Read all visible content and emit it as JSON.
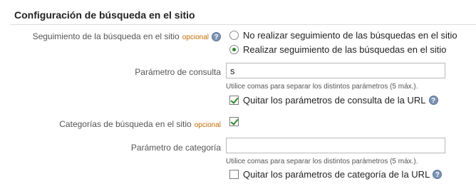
{
  "section": {
    "title": "Configuración de búsqueda en el sitio"
  },
  "tracking": {
    "label": "Seguimiento de la búsqueda en el sitio",
    "optional": "opcional",
    "options": [
      {
        "label": "No realizar seguimiento de las búsquedas en el sitio",
        "selected": false
      },
      {
        "label": "Realizar seguimiento de las búsquedas en el sitio",
        "selected": true
      }
    ]
  },
  "query_param": {
    "label": "Parámetro de consulta",
    "value": "s",
    "hint": "Utilice comas para separar los distintos parámetros (5 máx.).",
    "strip_label": "Quitar los parámetros de consulta de la URL",
    "strip_checked": true
  },
  "categories": {
    "label": "Categorías de búsqueda en el sitio",
    "optional": "opcional",
    "enabled": true
  },
  "category_param": {
    "label": "Parámetro de categoría",
    "value": "",
    "hint": "Utilice comas para separar los distintos parámetros (5 máx.).",
    "strip_label": "Quitar los parámetros de categoría de la URL",
    "strip_checked": false
  },
  "icons": {
    "help": "?"
  }
}
